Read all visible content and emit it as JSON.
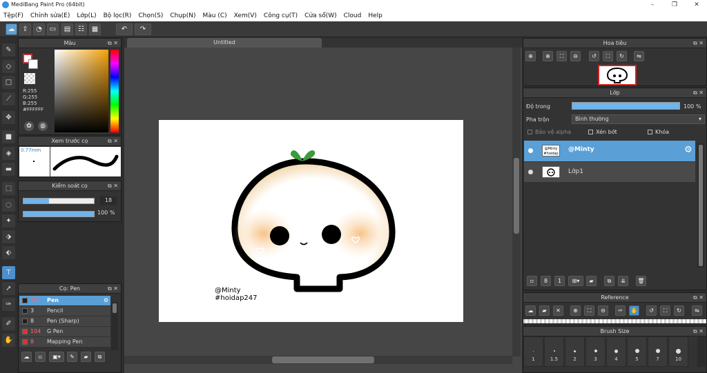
{
  "window": {
    "title": "MediBang Paint Pro (64bit)",
    "minimize": "–",
    "maximize": "❐",
    "close": "✕"
  },
  "menu": [
    "Tệp(F)",
    "Chỉnh sửa(E)",
    "Lớp(L)",
    "Bộ lọc(R)",
    "Chọn(S)",
    "Chụp(N)",
    "Màu (C)",
    "Xem(V)",
    "Công cụ(T)",
    "Cửa sổ(W)",
    "Cloud",
    "Help"
  ],
  "toolbar": {
    "undo": "↶",
    "redo": "↷"
  },
  "color_panel": {
    "title": "Màu",
    "r": "R:255",
    "g": "G:255",
    "b": "B:255",
    "hex": "#FFFFFF",
    "fg": "#ffffff",
    "bg": "#ffffff"
  },
  "brush_preview": {
    "title": "Xem trước cọ",
    "size": "0.77mm"
  },
  "brush_control": {
    "title": "Kiểm soát cọ",
    "size_value": "18",
    "opacity_value": "100 %",
    "size_fraction": 0.36,
    "opacity_fraction": 1.0
  },
  "brush_list": {
    "title": "Cọ: Pen",
    "items": [
      {
        "size": "18",
        "name": "Pen",
        "color": "#1e1e1e",
        "selected": true
      },
      {
        "size": "3",
        "name": "Pencil",
        "color": "#1e1e1e",
        "selected": false
      },
      {
        "size": "8",
        "name": "Pen (Sharp)",
        "color": "#1e1e1e",
        "selected": false
      },
      {
        "size": "104",
        "name": "G Pen",
        "color": "#e03030",
        "selected": false
      },
      {
        "size": "8",
        "name": "Mapping Pen",
        "color": "#e03030",
        "selected": false
      }
    ]
  },
  "document": {
    "tab": "Untitled",
    "caption_line1": "@Minty",
    "caption_line2": "#hoidap247"
  },
  "navigator": {
    "title": "Hoa tiêu"
  },
  "layer_panel": {
    "title": "Lớp",
    "opacity_label": "Độ trong",
    "opacity_value": "100 %",
    "opacity_fraction": 1.0,
    "blend_label": "Pha trộn",
    "blend_value": "Bình thường",
    "protect_alpha": "Bảo vệ alpha",
    "clipping": "Xén bớt",
    "lock": "Khóa",
    "layers": [
      {
        "name": "@Minty",
        "selected": true
      },
      {
        "name": "Lớp1",
        "selected": false
      }
    ]
  },
  "reference": {
    "title": "Reference"
  },
  "brush_size": {
    "title": "Brush Size",
    "sizes": [
      "1",
      "1.5",
      "2",
      "3",
      "4",
      "5",
      "7",
      "10"
    ]
  }
}
